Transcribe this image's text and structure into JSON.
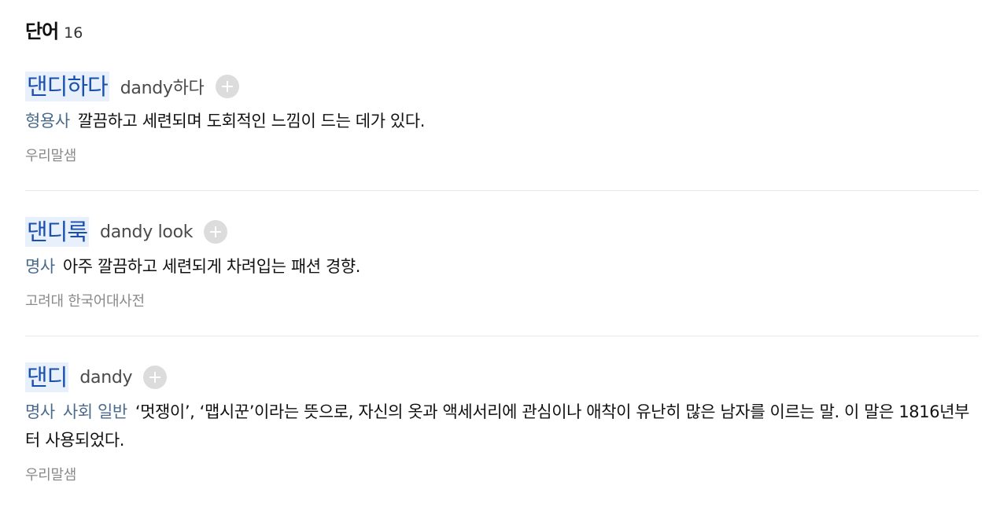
{
  "section": {
    "title": "단어",
    "count": "16"
  },
  "entries": [
    {
      "headword": "댄디하다",
      "origin": "dandy하다",
      "pos": "형용사",
      "definition": "깔끔하고 세련되며 도회적인 느낌이 드는 데가 있다.",
      "source": "우리말샘"
    },
    {
      "headword": "댄디룩",
      "origin": "dandy look",
      "pos": "명사",
      "definition": "아주 깔끔하고 세련되게 차려입는 패션 경향.",
      "source": "고려대 한국어대사전"
    },
    {
      "headword": "댄디",
      "origin": "dandy",
      "pos": "명사",
      "category": "사회 일반",
      "definition": "‘멋쟁이’, ‘맵시꾼’이라는 뜻으로, 자신의 옷과 액세서리에 관심이나 애착이 유난히 많은 남자를 이르는 말. 이 말은 1816년부터 사용되었다.",
      "source": "우리말샘"
    }
  ],
  "icons": {
    "add": "plus-circle-icon"
  },
  "colors": {
    "headword": "#1a4fb0",
    "headword_highlight": "#e7f0fb",
    "pos": "#4a6a8c",
    "source": "#8a8a8a"
  }
}
